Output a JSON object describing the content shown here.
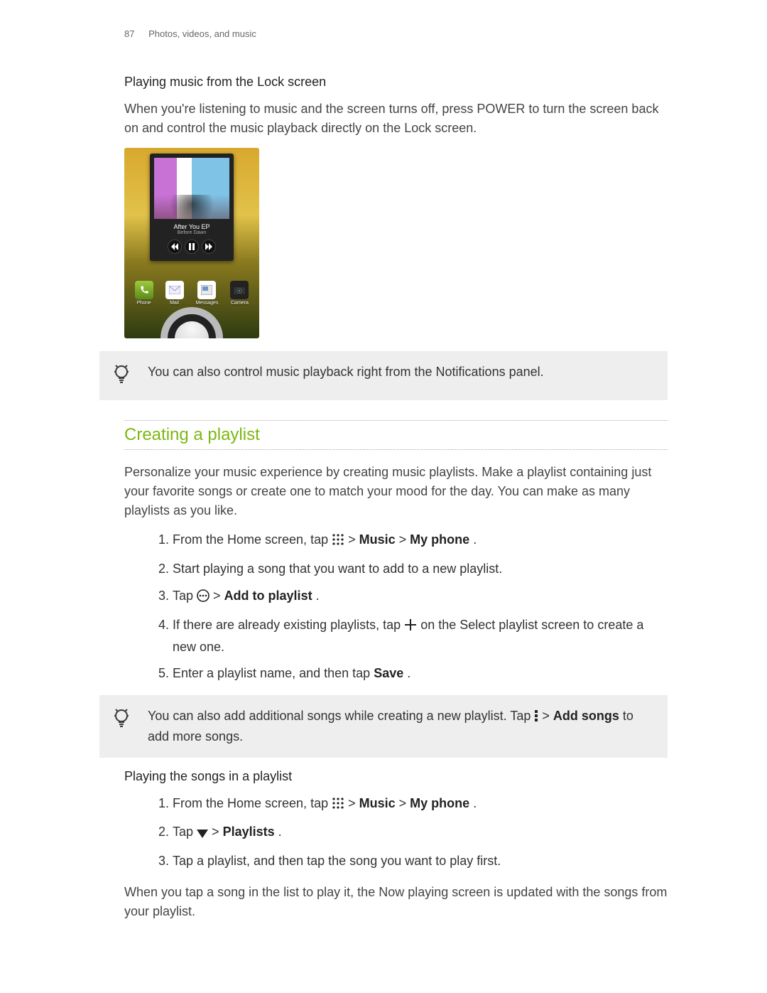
{
  "header": {
    "page_number": "87",
    "chapter": "Photos, videos, and music"
  },
  "sec_lock": {
    "heading": "Playing music from the Lock screen",
    "paragraph": "When you're listening to music and the screen turns off, press POWER to turn the screen back on and control the music playback directly on the Lock screen."
  },
  "lockscreen": {
    "track_title": "After You EP",
    "track_artist": "Before Dawn",
    "dock": [
      "Phone",
      "Mail",
      "Messages",
      "Camera"
    ]
  },
  "tip1": "You can also control music playback right from the Notifications panel.",
  "sec_playlist": {
    "heading": "Creating a playlist",
    "intro": "Personalize your music experience by creating music playlists. Make a playlist containing just your favorite songs or create one to match your mood for the day. You can make as many playlists as you like.",
    "step1_a": "From the Home screen, tap ",
    "step1_b": " > ",
    "step1_music": "Music",
    "step1_c": " > ",
    "step1_myphone": "My phone",
    "step1_end": ".",
    "step2": "Start playing a song that you want to add to a new playlist.",
    "step3_a": "Tap ",
    "step3_b": " > ",
    "step3_add": "Add to playlist",
    "step3_end": ".",
    "step4_a": "If there are already existing playlists, tap ",
    "step4_b": " on the Select playlist screen to create a new one.",
    "step5_a": "Enter a playlist name, and then tap ",
    "step5_save": "Save",
    "step5_end": "."
  },
  "tip2": {
    "a": "You can also add additional songs while creating a new playlist. Tap ",
    "b": " > ",
    "add_songs": "Add songs",
    "c": " to add more songs."
  },
  "sec_play_songs": {
    "heading": "Playing the songs in a playlist",
    "step1_a": "From the Home screen, tap ",
    "step1_b": " > ",
    "step1_music": "Music",
    "step1_c": " > ",
    "step1_myphone": "My phone",
    "step1_end": ".",
    "step2_a": "Tap ",
    "step2_b": " > ",
    "step2_playlists": "Playlists",
    "step2_end": ".",
    "step3": "Tap a playlist, and then tap the song you want to play first.",
    "outro": "When you tap a song in the list to play it, the Now playing screen is updated with the songs from your playlist."
  }
}
